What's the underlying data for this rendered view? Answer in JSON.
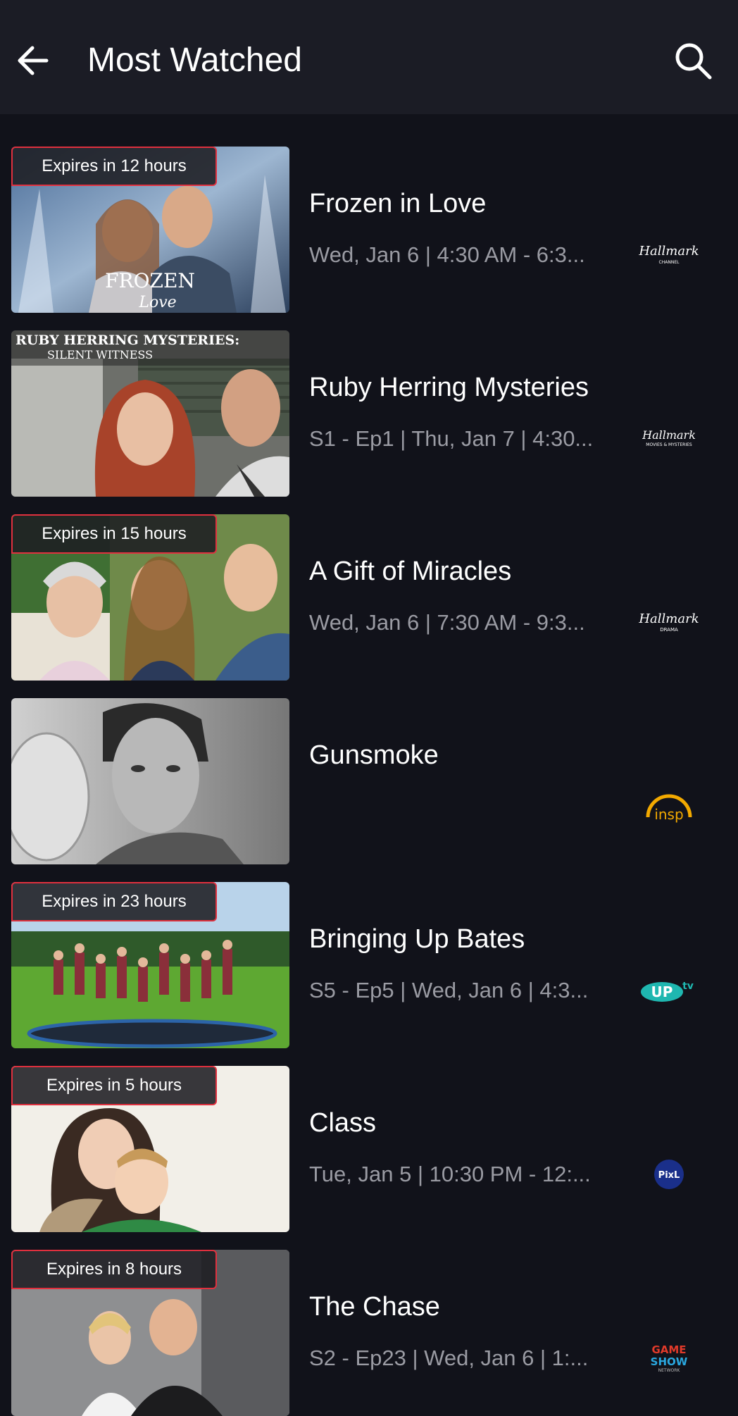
{
  "header": {
    "title": "Most Watched",
    "back_icon": "arrow-left-icon",
    "search_icon": "search-icon"
  },
  "colors": {
    "background": "#11121a",
    "header_bg": "#1b1c25",
    "badge_border": "#e0303e",
    "meta_text": "#9a9ba3"
  },
  "items": [
    {
      "title": "Frozen in Love",
      "meta": "Wed, Jan 6 | 4:30 AM - 6:3...",
      "badge": "Expires in 12 hours",
      "network": "Hallmark Channel"
    },
    {
      "title": "Ruby Herring Mysteries",
      "meta": "S1 - Ep1 | Thu, Jan 7 | 4:30...",
      "badge": "",
      "network": "Hallmark Movies & Mysteries",
      "thumb_text": [
        "RUBY HERRING MYSTERIES:",
        "SILENT WITNESS"
      ]
    },
    {
      "title": "A Gift of Miracles",
      "meta": "Wed, Jan 6 | 7:30 AM - 9:3...",
      "badge": "Expires in 15 hours",
      "network": "Hallmark Drama"
    },
    {
      "title": "Gunsmoke",
      "meta": "",
      "badge": "",
      "network": "insp"
    },
    {
      "title": "Bringing Up Bates",
      "meta": "S5 - Ep5 | Wed, Jan 6 | 4:3...",
      "badge": "Expires in 23 hours",
      "network": "UPtv"
    },
    {
      "title": "Class",
      "meta": "Tue, Jan 5 | 10:30 PM - 12:...",
      "badge": "Expires in 5 hours",
      "network": "PixL"
    },
    {
      "title": "The Chase",
      "meta": "S2 - Ep23 | Wed, Jan 6 | 1:...",
      "badge": "Expires in 8 hours",
      "network": "Game Show Network"
    }
  ],
  "logo_text": {
    "hallmark": "Hallmark",
    "hallmark_channel_sub": "CHANNEL",
    "hallmark_mm_sub": "MOVIES & MYSTERIES",
    "hallmark_drama_sub": "DRAMA",
    "insp": "insp",
    "uptv": "UP",
    "uptv_sup": "tv",
    "pixl": "PixL",
    "gsn_1": "GAME",
    "gsn_2": "SHOW",
    "gsn_3": "NETWORK",
    "frozen_title": "FROZEN",
    "frozen_sub": "Love"
  }
}
